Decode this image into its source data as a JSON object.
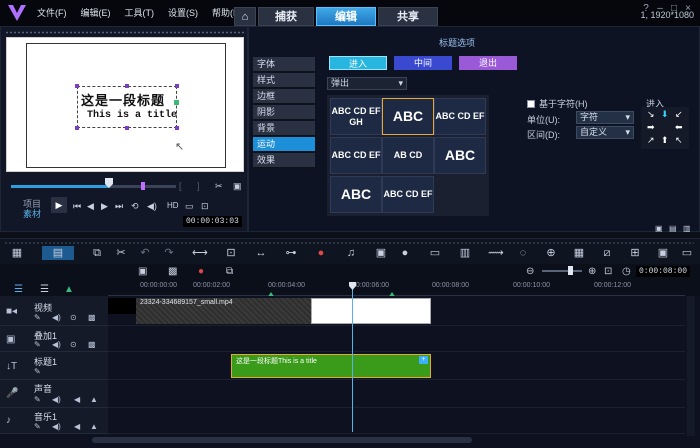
{
  "menu": [
    "文件(F)",
    "编辑(E)",
    "工具(T)",
    "设置(S)",
    "帮助(H)"
  ],
  "tabs": [
    {
      "label": "⌂",
      "active": false
    },
    {
      "label": "捕获",
      "active": false
    },
    {
      "label": "编辑",
      "active": true
    },
    {
      "label": "共享",
      "active": false
    }
  ],
  "resolution": "1, 1920*1080",
  "preview": {
    "title_line1": "这是一段标题",
    "title_line2": "This is a title",
    "project_label": "项目",
    "clip_label": "素材",
    "timecode": "00:00:03:03"
  },
  "title_options": {
    "heading": "标题选项",
    "side_tabs": [
      "字体",
      "样式",
      "边框",
      "阴影",
      "背景",
      "运动",
      "效果"
    ],
    "active_tab": "运动",
    "mode_buttons": [
      "进入",
      "中间",
      "退出"
    ],
    "dropdown_value": "弹出",
    "grid_cells": [
      "ABC CD EF GH",
      "ABC",
      "ABC CD EF",
      "ABC CD EF",
      "AB CD",
      "ABC",
      "ABC",
      "ABC CD EF",
      ""
    ],
    "checkbox_label": "基于字符(H)",
    "unit_label": "单位(U):",
    "unit_value": "字符",
    "interval_label": "区间(D):",
    "interval_value": "自定义",
    "direction_label": "进入"
  },
  "timeline": {
    "ruler_ticks": [
      "00:00:00:00",
      "00:00:02:00",
      "00:00:04:00",
      "00:00:06:00",
      "00:00:08:00",
      "00:00:10:00",
      "00:00:12:00"
    ],
    "zoom_timecode": "0:00:08:00",
    "tracks": [
      {
        "name": "视频"
      },
      {
        "name": "叠加1"
      },
      {
        "name": "标题1"
      },
      {
        "name": "声音"
      },
      {
        "name": "音乐1"
      }
    ],
    "video_clip_name": "23324-334689157_small.mp4",
    "title_clip_text": "这是一段标题This is a title"
  },
  "colors": {
    "accent": "#1c8fd8",
    "enter_btn": "#27b6e0",
    "middle_btn": "#3a4ad0",
    "exit_btn": "#9a5ad8",
    "title_clip": "#3a9a1a",
    "playhead": "#5ab0e8"
  }
}
